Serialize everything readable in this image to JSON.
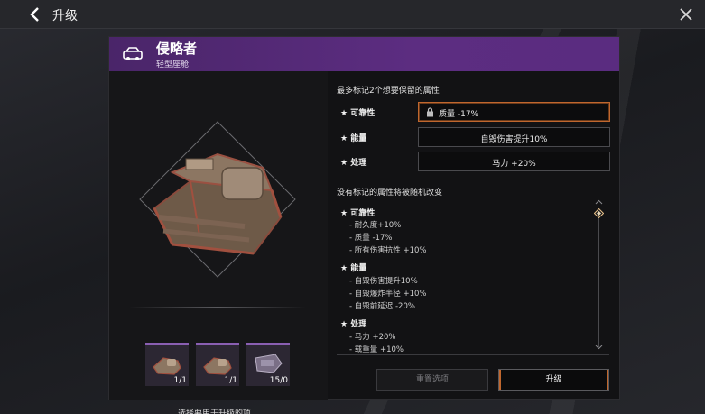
{
  "topbar": {
    "title": "升级"
  },
  "item": {
    "name": "侵略者",
    "subtitle": "轻型座舱"
  },
  "slots": [
    {
      "count": "1/1"
    },
    {
      "count": "1/1"
    },
    {
      "count": "15/0"
    }
  ],
  "select_hint": "选择要用于升级的项。",
  "keep": {
    "title": "最多标记2个想要保留的属性",
    "rows": [
      {
        "label": "★ 可靠性",
        "value": "质量 -17%",
        "locked": true
      },
      {
        "label": "★ 能量",
        "value": "自毁伤害提升10%",
        "locked": false
      },
      {
        "label": "★ 处理",
        "value": "马力 +20%",
        "locked": false
      }
    ]
  },
  "random": {
    "title": "没有标记的属性将被随机改变",
    "groups": [
      {
        "title": "★ 可靠性",
        "lines": [
          "- 耐久度+10%",
          "- 质量 -17%",
          "- 所有伤害抗性 +10%"
        ]
      },
      {
        "title": "★ 能量",
        "lines": [
          "- 自毁伤害提升10%",
          "- 自毁爆炸半径 +10%",
          "- 自毁前延迟 -20%"
        ]
      },
      {
        "title": "★ 处理",
        "lines": [
          "- 马力 +20%",
          "- 载重量 +10%"
        ]
      }
    ]
  },
  "buttons": {
    "reset": "重置选项",
    "upgrade": "升级"
  },
  "colors": {
    "header_purple": "#5c2d81",
    "accent_orange": "#c0672e",
    "panel_bg": "#121214"
  },
  "icons": [
    "back-arrow",
    "close-x",
    "car",
    "lock",
    "diamond-scroll-thumb"
  ]
}
